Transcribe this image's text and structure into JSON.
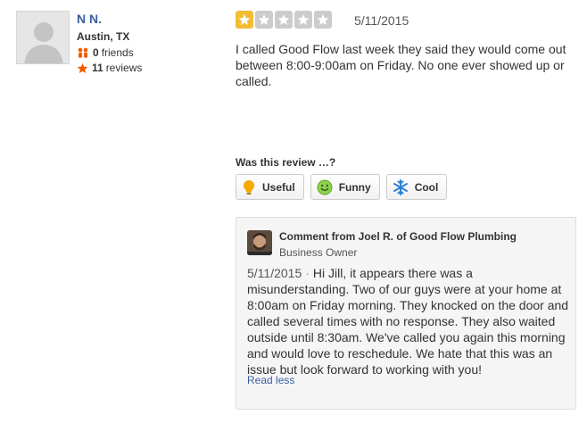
{
  "user": {
    "name": "N N.",
    "location": "Austin, TX",
    "friends_count": "0",
    "friends_label": "friends",
    "reviews_count": "11",
    "reviews_label": "reviews"
  },
  "review": {
    "rating": 1,
    "max_rating": 5,
    "colors": {
      "filled": "#f2bd33",
      "empty": "#cccccc"
    },
    "date": "5/11/2015",
    "text": "I called Good Flow last week they said they would come out between 8:00-9:00am on Friday.  No one ever showed up or called."
  },
  "feedback": {
    "question": "Was this review …?",
    "buttons": [
      {
        "label": "Useful",
        "icon": "lightbulb-icon"
      },
      {
        "label": "Funny",
        "icon": "smiley-icon"
      },
      {
        "label": "Cool",
        "icon": "snowflake-icon"
      }
    ]
  },
  "owner_comment": {
    "from": "Comment from Joel R. of Good Flow Plumbing",
    "role": "Business Owner",
    "date": "5/11/2015",
    "separator": "·",
    "text": "Hi Jill, it appears there was a misunderstanding. Two of our guys were at your home at 8:00am on Friday morning. They knocked on the door and called several times with no response. They also waited outside until 8:30am. We've called you again this morning and would love to reschedule. We hate that this was an issue but look forward to working with you!",
    "read_less": "Read less"
  }
}
